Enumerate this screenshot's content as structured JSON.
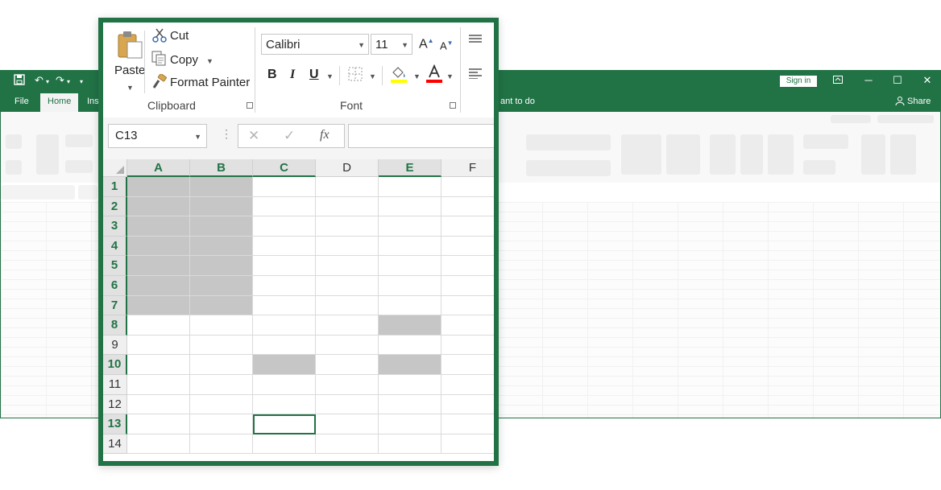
{
  "app": {
    "tabs": [
      {
        "label": "File",
        "active": false
      },
      {
        "label": "Home",
        "active": true
      },
      {
        "label": "Inse",
        "active": false
      }
    ],
    "tell_me_text": "ant to do",
    "sign_in_label": "Sign in",
    "share_label": "Share",
    "brand_color": "#217346"
  },
  "ribbon": {
    "clipboard": {
      "paste_label": "Paste",
      "cut_label": "Cut",
      "copy_label": "Copy",
      "format_painter_label": "Format Painter",
      "group_label": "Clipboard"
    },
    "font": {
      "font_name": "Calibri",
      "font_size": "11",
      "group_label": "Font",
      "bold": "B",
      "italic": "I",
      "underline": "U",
      "grow_glyph": "A",
      "shrink_glyph": "A",
      "fill_color": "#ffff00",
      "font_color": "#ff0000",
      "fx_label": "fx"
    }
  },
  "formula_bar": {
    "name_box": "C13",
    "formula": ""
  },
  "sheet": {
    "columns": [
      "A",
      "B",
      "C",
      "D",
      "E",
      "F"
    ],
    "selected_columns": [
      "A",
      "B",
      "C",
      "E"
    ],
    "rows": [
      "1",
      "2",
      "3",
      "4",
      "5",
      "6",
      "7",
      "8",
      "9",
      "10",
      "11",
      "12",
      "13",
      "14"
    ],
    "selected_rows": [
      "1",
      "2",
      "3",
      "4",
      "5",
      "6",
      "7",
      "8",
      "10",
      "13"
    ],
    "selected_cells": [
      "A1",
      "B1",
      "A2",
      "B2",
      "A3",
      "B3",
      "A4",
      "B4",
      "A5",
      "B5",
      "A6",
      "B6",
      "A7",
      "B7",
      "E8",
      "C10",
      "E10"
    ],
    "active_cell": "C13"
  }
}
